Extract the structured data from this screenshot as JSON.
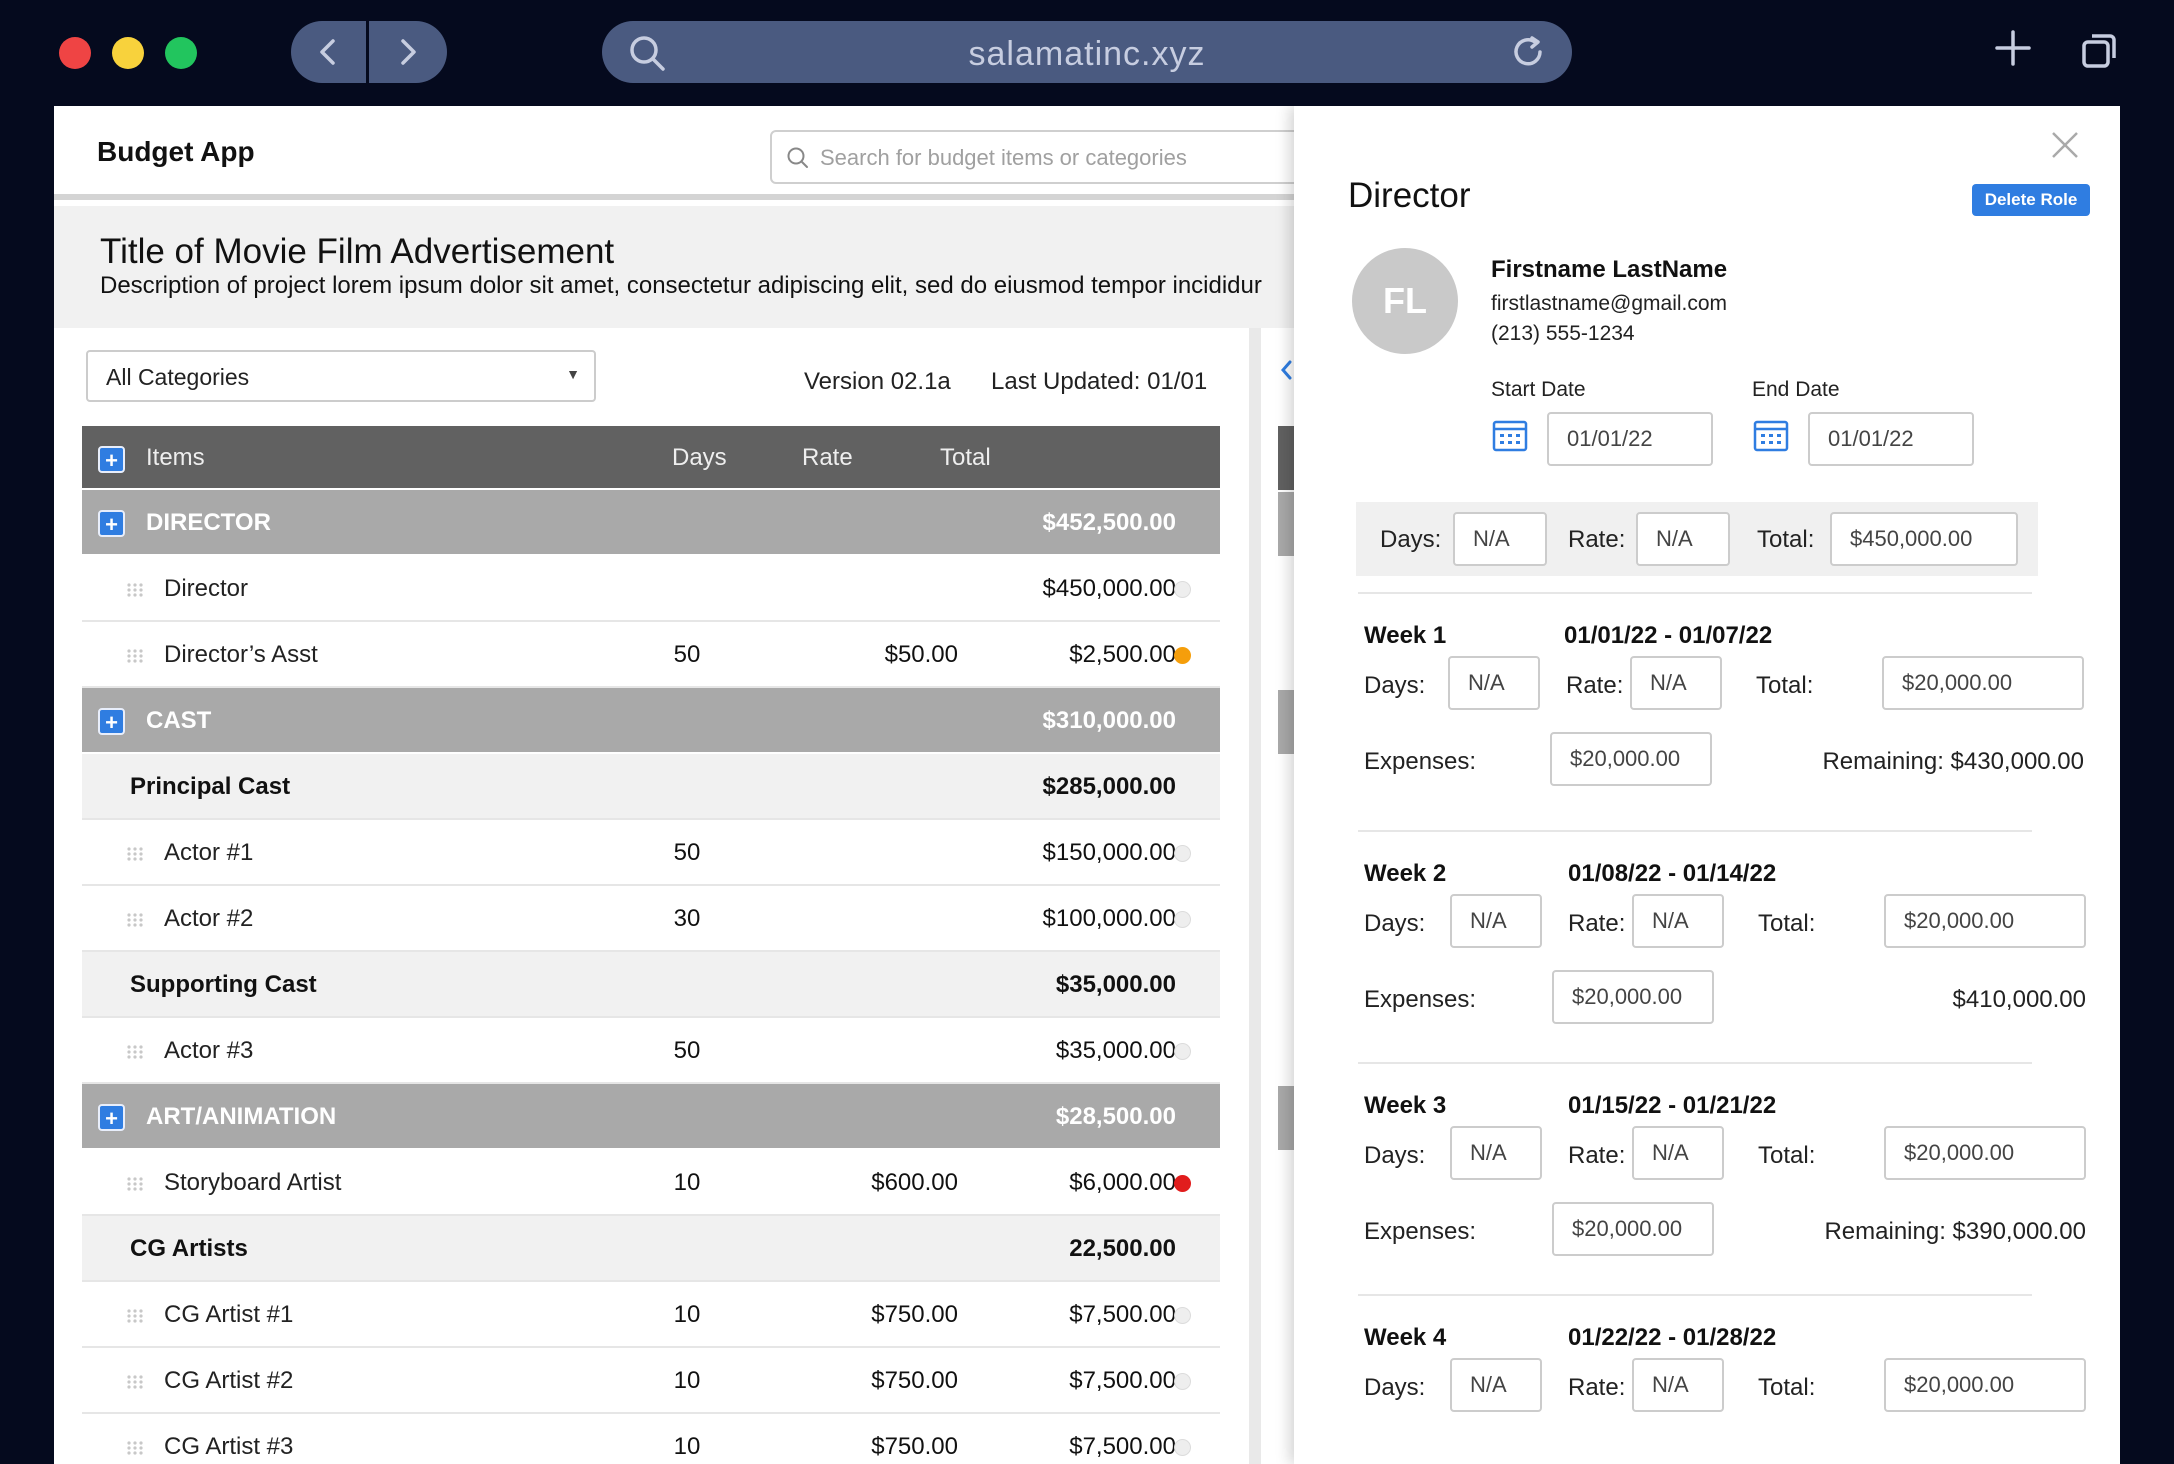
{
  "browser": {
    "url": "salamatinc.xyz",
    "colors": {
      "close": "#ef4444",
      "minimize": "#f8d23c",
      "maximize": "#22c55e"
    }
  },
  "app": {
    "name": "Budget App",
    "search_placeholder": "Search for budget items or categories"
  },
  "project": {
    "title": "Title of Movie Film Advertisement",
    "description": "Description of project lorem ipsum dolor sit amet, consectetur adipiscing elit, sed do eiusmod tempor incididur"
  },
  "filters": {
    "category_value": "All Categories",
    "version": "Version  02.1a",
    "last_updated": "Last Updated: 01/01"
  },
  "table": {
    "headers": {
      "items": "Items",
      "days": "Days",
      "rate": "Rate",
      "total": "Total"
    },
    "rows": [
      {
        "kind": "cat",
        "name": "DIRECTOR",
        "total": "$452,500.00"
      },
      {
        "kind": "item",
        "name": "Director",
        "days": "",
        "rate": "",
        "total": "$450,000.00",
        "status": "#eeeeee"
      },
      {
        "kind": "item",
        "name": "Director’s Asst",
        "days": "50",
        "rate": "$50.00",
        "total": "$2,500.00",
        "status": "#f59e0b"
      },
      {
        "kind": "cat",
        "name": "CAST",
        "total": "$310,000.00"
      },
      {
        "kind": "sub",
        "name": "Principal Cast",
        "total": "$285,000.00"
      },
      {
        "kind": "item",
        "name": "Actor #1",
        "days": "50",
        "rate": "",
        "total": "$150,000.00",
        "status": "#eeeeee"
      },
      {
        "kind": "item",
        "name": "Actor #2",
        "days": "30",
        "rate": "",
        "total": "$100,000.00",
        "status": "#eeeeee"
      },
      {
        "kind": "sub",
        "name": "Supporting Cast",
        "total": "$35,000.00"
      },
      {
        "kind": "item",
        "name": "Actor #3",
        "days": "50",
        "rate": "",
        "total": "$35,000.00",
        "status": "#eeeeee"
      },
      {
        "kind": "cat",
        "name": "ART/ANIMATION",
        "total": "$28,500.00"
      },
      {
        "kind": "item",
        "name": "Storyboard Artist",
        "days": "10",
        "rate": "$600.00",
        "total": "$6,000.00",
        "status": "#e11d1d"
      },
      {
        "kind": "sub",
        "name": "CG Artists",
        "total": "22,500.00"
      },
      {
        "kind": "item",
        "name": "CG Artist #1",
        "days": "10",
        "rate": "$750.00",
        "total": "$7,500.00",
        "status": "#eeeeee"
      },
      {
        "kind": "item",
        "name": "CG Artist #2",
        "days": "10",
        "rate": "$750.00",
        "total": "$7,500.00",
        "status": "#eeeeee"
      },
      {
        "kind": "item",
        "name": "CG Artist #3",
        "days": "10",
        "rate": "$750.00",
        "total": "$7,500.00",
        "status": "#eeeeee"
      }
    ]
  },
  "panel": {
    "role": "Director",
    "delete_label": "Delete Role",
    "person": {
      "initials": "FL",
      "name": "Firstname LastName",
      "email": "firstlastname@gmail.com",
      "phone": "(213) 555-1234"
    },
    "start_label": "Start Date",
    "start_value": "01/01/22",
    "end_label": "End Date",
    "end_value": "01/01/22",
    "summary": {
      "days_label": "Days:",
      "days": "N/A",
      "rate_label": "Rate:",
      "rate": "N/A",
      "total_label": "Total:",
      "total": "$450,000.00"
    },
    "weeks": [
      {
        "title": "Week 1",
        "range": "01/01/22 - 01/07/22",
        "days": "N/A",
        "rate": "N/A",
        "total": "$20,000.00",
        "expenses": "$20,000.00",
        "remaining": "Remaining: $430,000.00"
      },
      {
        "title": "Week 2",
        "range": "01/08/22 - 01/14/22",
        "days": "N/A",
        "rate": "N/A",
        "total": "$20,000.00",
        "expenses": "$20,000.00",
        "remaining": "$410,000.00"
      },
      {
        "title": "Week 3",
        "range": "01/15/22 - 01/21/22",
        "days": "N/A",
        "rate": "N/A",
        "total": "$20,000.00",
        "expenses": "$20,000.00",
        "remaining": "Remaining: $390,000.00"
      },
      {
        "title": "Week 4",
        "range": "01/22/22 - 01/28/22",
        "days": "N/A",
        "rate": "N/A",
        "total": "$20,000.00",
        "expenses": "",
        "remaining": ""
      }
    ],
    "labels": {
      "days": "Days:",
      "rate": "Rate:",
      "total": "Total:",
      "expenses": "Expenses:"
    }
  }
}
